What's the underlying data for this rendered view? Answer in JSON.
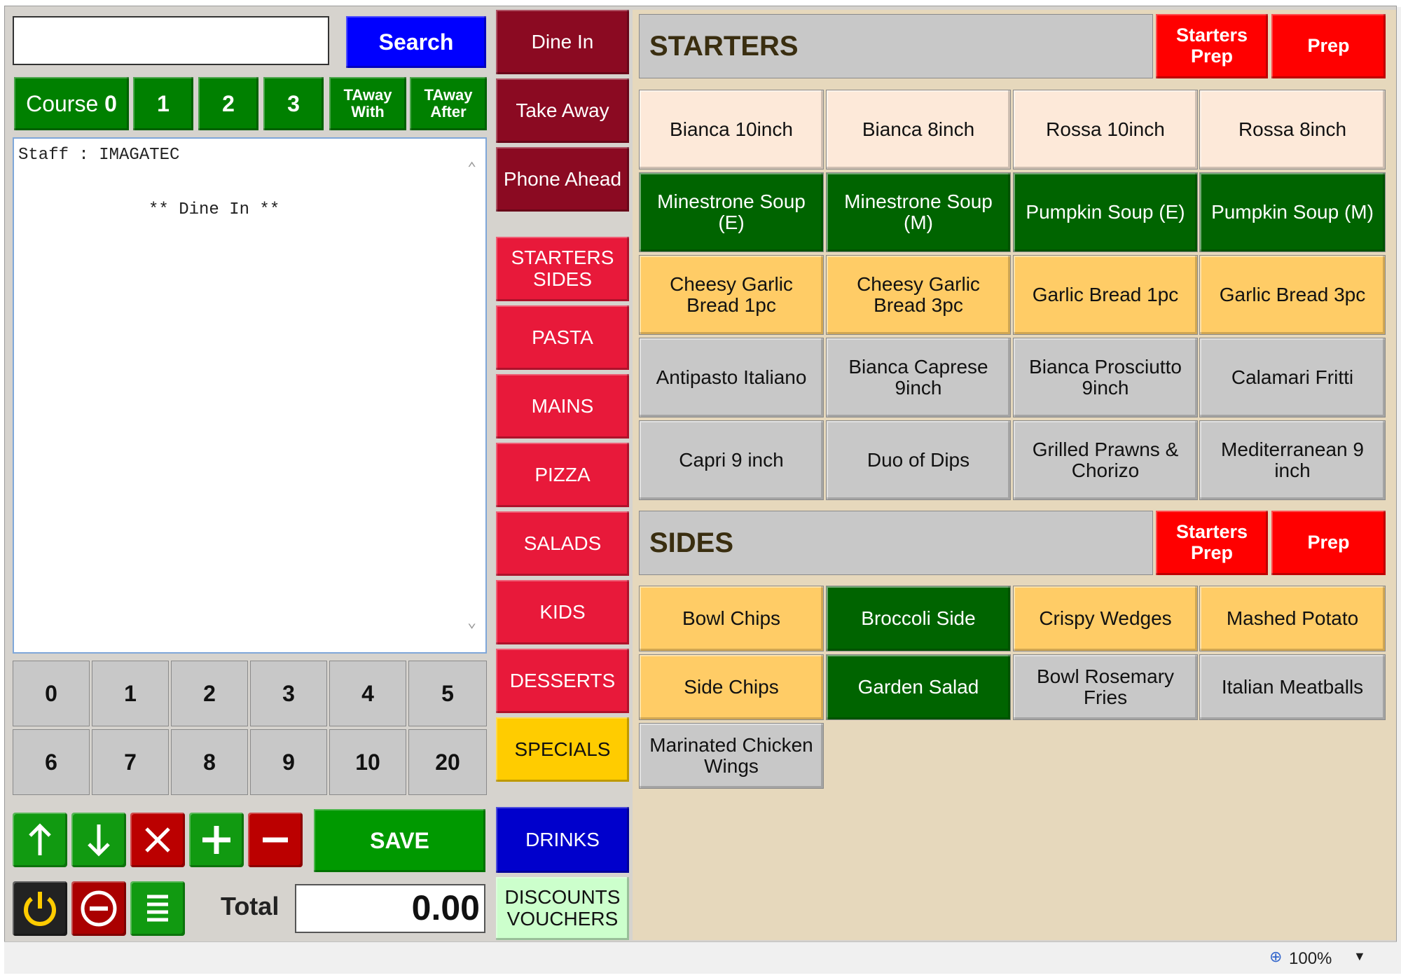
{
  "search": {
    "value": "",
    "button_label": "Search"
  },
  "course_bar": [
    {
      "label": "Course",
      "num": "0"
    },
    {
      "label": "",
      "num": "1"
    },
    {
      "label": "",
      "num": "2"
    },
    {
      "label": "",
      "num": "3"
    },
    {
      "label": "TAway\nWith",
      "num": ""
    },
    {
      "label": "TAway\nAfter",
      "num": ""
    }
  ],
  "receipt": {
    "staff_line": "Staff : IMAGATEC",
    "mode_line": "** Dine In **"
  },
  "keypad": [
    "0",
    "1",
    "2",
    "3",
    "4",
    "5",
    "6",
    "7",
    "8",
    "9",
    "10",
    "20"
  ],
  "actions": {
    "icons": [
      "arrow-up-icon",
      "arrow-down-icon",
      "delete-x-icon",
      "plus-icon",
      "minus-icon"
    ],
    "save_label": "SAVE",
    "bottom_icons": [
      "power-icon",
      "no-entry-icon",
      "menu-list-icon"
    ],
    "total_label": "Total",
    "total_value": "0.00"
  },
  "order_types": [
    "Dine In",
    "Take Away",
    "Phone Ahead"
  ],
  "categories": [
    {
      "label": "STARTERS\nSIDES",
      "color": "#e8193a"
    },
    {
      "label": "PASTA",
      "color": "#e8193a"
    },
    {
      "label": "MAINS",
      "color": "#e8193a"
    },
    {
      "label": "PIZZA",
      "color": "#e8193a"
    },
    {
      "label": "SALADS",
      "color": "#e8193a"
    },
    {
      "label": "KIDS",
      "color": "#e8193a"
    },
    {
      "label": "DESSERTS",
      "color": "#e8193a"
    },
    {
      "label": "SPECIALS",
      "color": "#ffcc00"
    }
  ],
  "bottom_categories": [
    {
      "label": "DRINKS",
      "color": "#0000cc"
    },
    {
      "label": "DISCOUNTS\nVOUCHERS",
      "color": "#ccffcc"
    }
  ],
  "starters": {
    "title": "STARTERS",
    "prep_buttons": [
      "Starters\nPrep",
      "Prep"
    ],
    "items": [
      {
        "label": "Bianca 10inch",
        "color": "cream"
      },
      {
        "label": "Bianca 8inch",
        "color": "cream"
      },
      {
        "label": "Rossa 10inch",
        "color": "cream"
      },
      {
        "label": "Rossa 8inch",
        "color": "cream"
      },
      {
        "label": "Minestrone Soup (E)",
        "color": "green"
      },
      {
        "label": "Minestrone Soup (M)",
        "color": "green"
      },
      {
        "label": "Pumpkin Soup (E)",
        "color": "green"
      },
      {
        "label": "Pumpkin Soup (M)",
        "color": "green"
      },
      {
        "label": "Cheesy Garlic Bread 1pc",
        "color": "yellow"
      },
      {
        "label": "Cheesy Garlic Bread 3pc",
        "color": "yellow"
      },
      {
        "label": "Garlic Bread 1pc",
        "color": "yellow"
      },
      {
        "label": "Garlic Bread 3pc",
        "color": "yellow"
      },
      {
        "label": "Antipasto Italiano",
        "color": "grey"
      },
      {
        "label": "Bianca Caprese 9inch",
        "color": "grey"
      },
      {
        "label": "Bianca Prosciutto 9inch",
        "color": "grey"
      },
      {
        "label": "Calamari Fritti",
        "color": "grey"
      },
      {
        "label": "Capri 9 inch",
        "color": "grey"
      },
      {
        "label": "Duo of Dips",
        "color": "grey"
      },
      {
        "label": "Grilled Prawns & Chorizo",
        "color": "grey"
      },
      {
        "label": "Mediterranean 9 inch",
        "color": "grey"
      }
    ]
  },
  "sides": {
    "title": "SIDES",
    "prep_buttons": [
      "Starters\nPrep",
      "Prep"
    ],
    "items": [
      {
        "label": "Bowl Chips",
        "color": "yellow"
      },
      {
        "label": "Broccoli Side",
        "color": "green"
      },
      {
        "label": "Crispy Wedges",
        "color": "yellow"
      },
      {
        "label": "Mashed Potato",
        "color": "yellow"
      },
      {
        "label": "Side Chips",
        "color": "yellow"
      },
      {
        "label": "Garden Salad",
        "color": "green"
      },
      {
        "label": "Bowl Rosemary Fries",
        "color": "grey"
      },
      {
        "label": "Italian Meatballs",
        "color": "grey"
      },
      {
        "label": "Marinated Chicken Wings",
        "color": "grey"
      }
    ]
  },
  "status_bar": {
    "zoom": "100%"
  }
}
